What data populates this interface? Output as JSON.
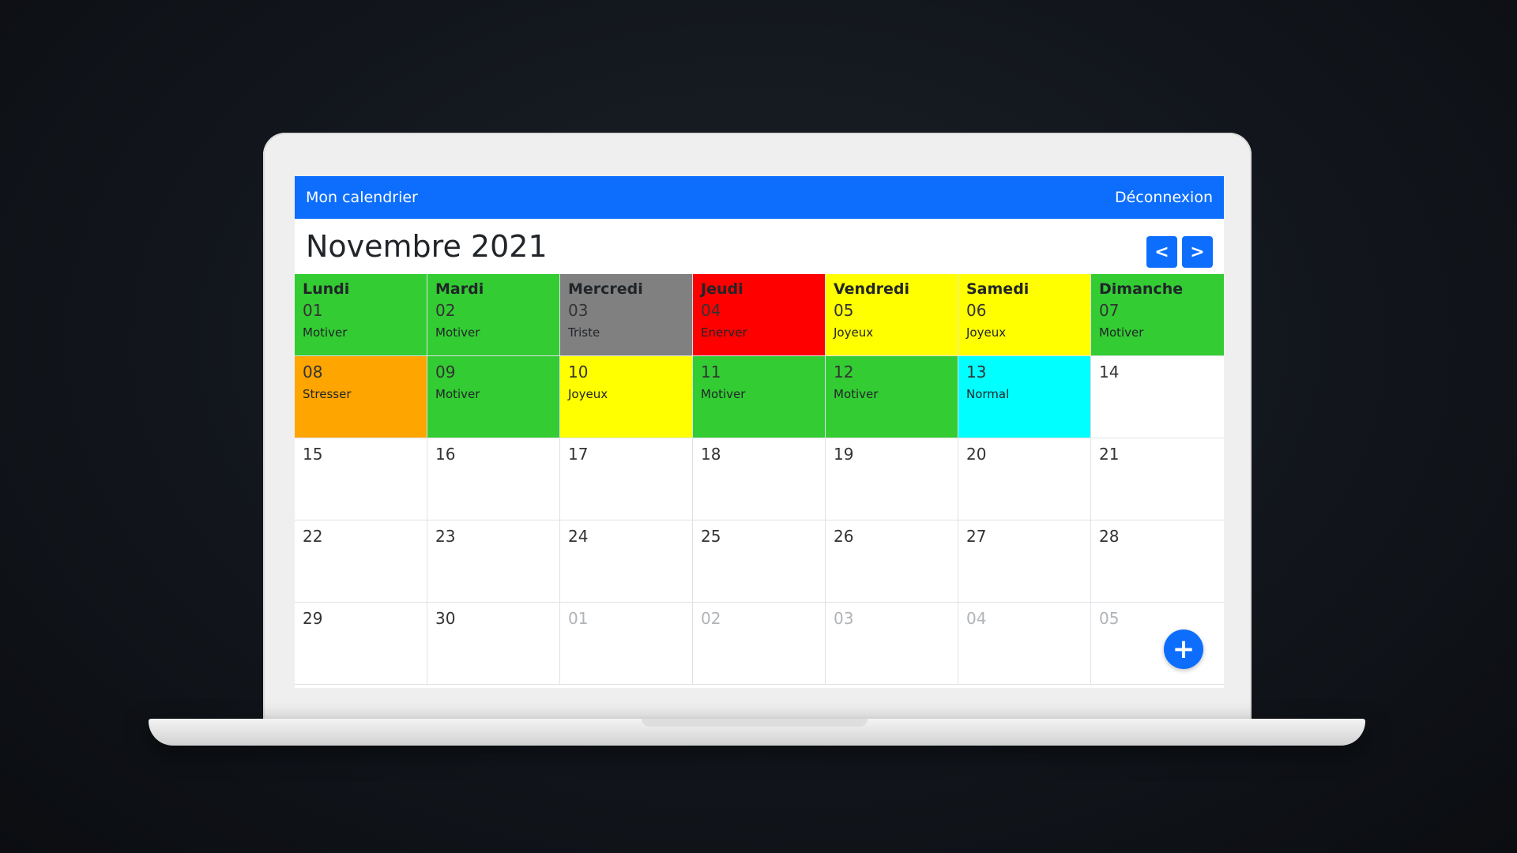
{
  "navbar": {
    "brand": "Mon calendrier",
    "logout": "Déconnexion"
  },
  "calendar": {
    "title": "Novembre 2021",
    "prev_label": "<",
    "next_label": ">",
    "add_label": "+",
    "weeks": [
      [
        {
          "weekday": "Lundi",
          "day": "01",
          "mood": "Motiver",
          "color": "#33cc33"
        },
        {
          "weekday": "Mardi",
          "day": "02",
          "mood": "Motiver",
          "color": "#33cc33"
        },
        {
          "weekday": "Mercredi",
          "day": "03",
          "mood": "Triste",
          "color": "#808080"
        },
        {
          "weekday": "Jeudi",
          "day": "04",
          "mood": "Enerver",
          "color": "#ff0000"
        },
        {
          "weekday": "Vendredi",
          "day": "05",
          "mood": "Joyeux",
          "color": "#ffff00"
        },
        {
          "weekday": "Samedi",
          "day": "06",
          "mood": "Joyeux",
          "color": "#ffff00"
        },
        {
          "weekday": "Dimanche",
          "day": "07",
          "mood": "Motiver",
          "color": "#33cc33"
        }
      ],
      [
        {
          "day": "08",
          "mood": "Stresser",
          "color": "#ffa500"
        },
        {
          "day": "09",
          "mood": "Motiver",
          "color": "#33cc33"
        },
        {
          "day": "10",
          "mood": "Joyeux",
          "color": "#ffff00"
        },
        {
          "day": "11",
          "mood": "Motiver",
          "color": "#33cc33"
        },
        {
          "day": "12",
          "mood": "Motiver",
          "color": "#33cc33"
        },
        {
          "day": "13",
          "mood": "Normal",
          "color": "#00ffff"
        },
        {
          "day": "14",
          "color": "#ffffff"
        }
      ],
      [
        {
          "day": "15",
          "color": "#ffffff"
        },
        {
          "day": "16",
          "color": "#ffffff"
        },
        {
          "day": "17",
          "color": "#ffffff"
        },
        {
          "day": "18",
          "color": "#ffffff"
        },
        {
          "day": "19",
          "color": "#ffffff"
        },
        {
          "day": "20",
          "color": "#ffffff"
        },
        {
          "day": "21",
          "color": "#ffffff"
        }
      ],
      [
        {
          "day": "22",
          "color": "#ffffff"
        },
        {
          "day": "23",
          "color": "#ffffff"
        },
        {
          "day": "24",
          "color": "#ffffff"
        },
        {
          "day": "25",
          "color": "#ffffff"
        },
        {
          "day": "26",
          "color": "#ffffff"
        },
        {
          "day": "27",
          "color": "#ffffff"
        },
        {
          "day": "28",
          "color": "#ffffff"
        }
      ],
      [
        {
          "day": "29",
          "color": "#ffffff"
        },
        {
          "day": "30",
          "color": "#ffffff"
        },
        {
          "day": "01",
          "color": "#ffffff",
          "muted": true
        },
        {
          "day": "02",
          "color": "#ffffff",
          "muted": true
        },
        {
          "day": "03",
          "color": "#ffffff",
          "muted": true
        },
        {
          "day": "04",
          "color": "#ffffff",
          "muted": true
        },
        {
          "day": "05",
          "color": "#ffffff",
          "muted": true
        }
      ]
    ]
  }
}
